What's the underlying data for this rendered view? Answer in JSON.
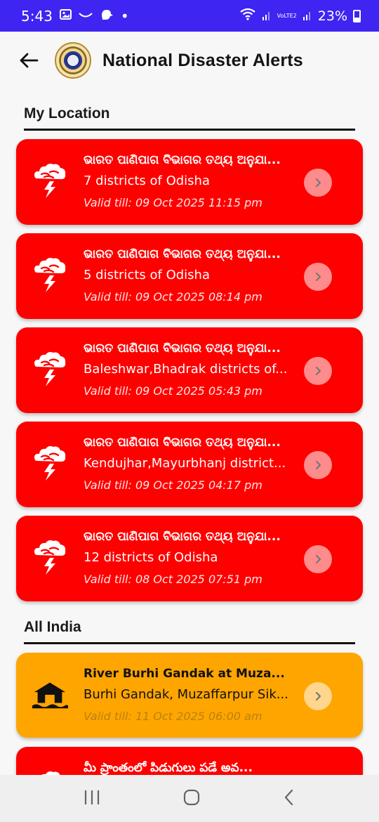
{
  "status_bar": {
    "time": "5:43",
    "dot": "•",
    "lte_label": "VoLTE2",
    "battery_percent": "23%"
  },
  "app_bar": {
    "title": "National Disaster Alerts"
  },
  "sections": {
    "my_location": "My Location",
    "all_india": "All India"
  },
  "my_location_alerts": [
    {
      "title": "ଭାରତ ପାଣିପାଗ ବିଭାଗର ତଥ୍ୟ ଅନୁଯା...",
      "area": "7 districts of Odisha",
      "valid": "Valid till: 09 Oct 2025 11:15 pm",
      "icon": "thunderstorm-icon"
    },
    {
      "title": "ଭାରତ ପାଣିପାଗ ବିଭାଗର ତଥ୍ୟ ଅନୁଯା...",
      "area": "5 districts of Odisha",
      "valid": "Valid till: 09 Oct 2025 08:14 pm",
      "icon": "thunderstorm-icon"
    },
    {
      "title": "ଭାରତ ପାଣିପାଗ ବିଭାଗର ତଥ୍ୟ ଅନୁଯା...",
      "area": "Baleshwar,Bhadrak districts of...",
      "valid": "Valid till: 09 Oct 2025 05:43 pm",
      "icon": "thunderstorm-icon"
    },
    {
      "title": "ଭାରତ ପାଣିପାଗ ବିଭାଗର ତଥ୍ୟ ଅନୁଯା...",
      "area": "Kendujhar,Mayurbhanj district...",
      "valid": "Valid till: 09 Oct 2025 04:17 pm",
      "icon": "thunderstorm-icon"
    },
    {
      "title": "ଭାରତ ପାଣିପାଗ ବିଭାଗର ତଥ୍ୟ ଅନୁଯା...",
      "area": "12 districts of Odisha",
      "valid": "Valid till: 08 Oct 2025 07:51 pm",
      "icon": "thunderstorm-icon"
    }
  ],
  "all_india_alerts": [
    {
      "title": "River Burhi Gandak at Muza...",
      "area": "Burhi Gandak, Muzaffarpur Sik...",
      "valid": "Valid till: 11 Oct 2025 06:00 am",
      "icon": "flood-icon"
    },
    {
      "title": "మీ ప్రాంతంలో పిడుగులు పడే అవ...",
      "icon": "thunderstorm-icon"
    }
  ],
  "colors": {
    "status_bar": "#3f25f2",
    "alert_red": "#ff0000",
    "alert_amber": "#ffa500"
  }
}
